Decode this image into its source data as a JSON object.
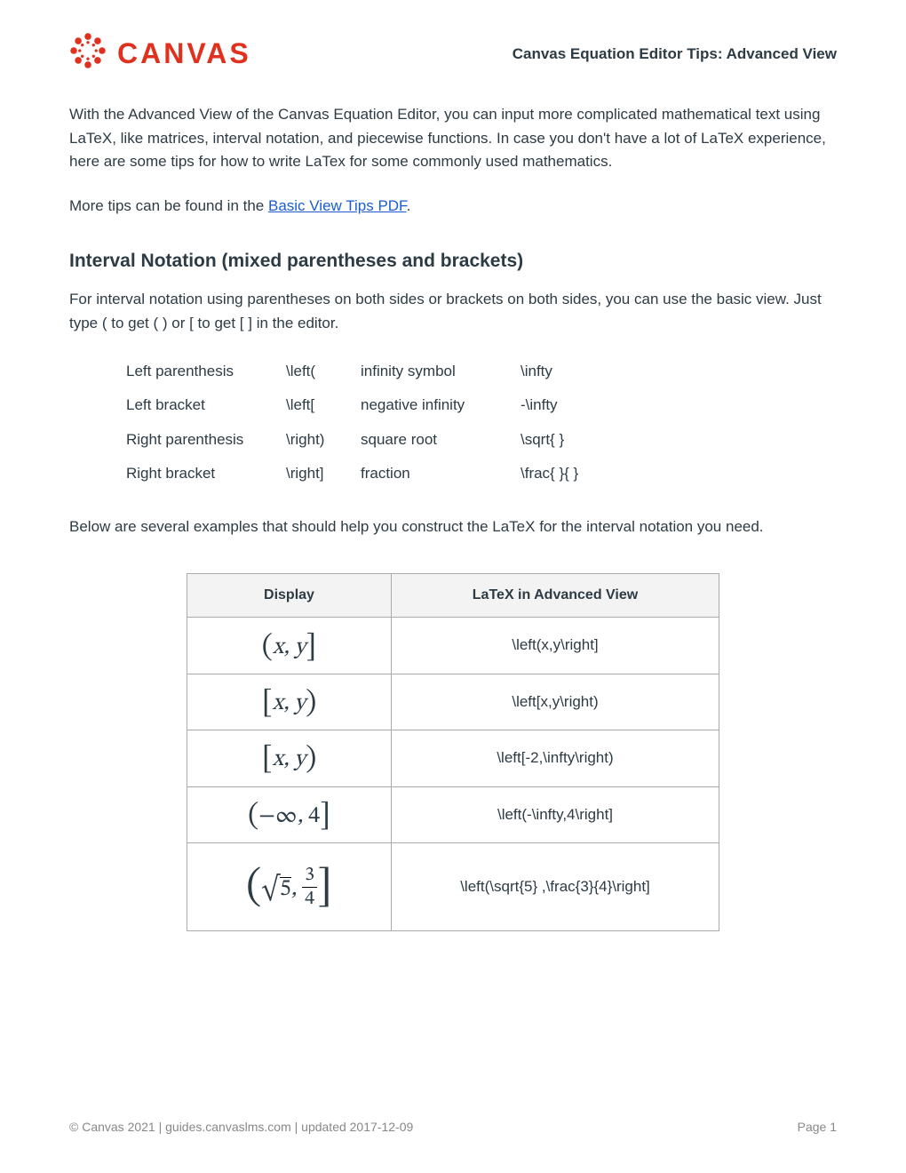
{
  "header": {
    "brand": "CANVAS",
    "title": "Canvas Equation Editor Tips: Advanced View"
  },
  "intro": "With the Advanced View of the Canvas Equation Editor, you can input more complicated mathematical text using LaTeX, like matrices, interval notation, and piecewise functions. In case you don't have a lot of LaTeX experience, here are some tips for how to write LaTex for some commonly used mathematics.",
  "more_tips_prefix": "More tips can be found in the ",
  "more_tips_link": "Basic View Tips PDF",
  "more_tips_suffix": ".",
  "section": {
    "title": "Interval Notation (mixed parentheses and brackets)",
    "desc": "For interval notation using parentheses on both sides or brackets on both sides, you can use the basic view. Just type ( to get ( ) or [ to get [ ] in the editor."
  },
  "sym_rows": [
    {
      "c1": "Left parenthesis",
      "c2": "\\left(",
      "c3": "infinity symbol",
      "c4": "\\infty"
    },
    {
      "c1": "Left bracket",
      "c2": "\\left[",
      "c3": "negative infinity",
      "c4": "-\\infty"
    },
    {
      "c1": "Right parenthesis",
      "c2": "\\right)",
      "c3": "square root",
      "c4": "\\sqrt{ }"
    },
    {
      "c1": "Right bracket",
      "c2": "\\right]",
      "c3": "fraction",
      "c4": "\\frac{ }{ }"
    }
  ],
  "below": "Below are several examples that should help you construct the LaTeX for the interval notation you need.",
  "ex_headers": {
    "display": "Display",
    "latex": "LaTeX in Advanced View"
  },
  "ex_rows": [
    {
      "latex": "\\left(x,y\\right]"
    },
    {
      "latex": "\\left[x,y\\right)"
    },
    {
      "latex": "\\left[-2,\\infty\\right)"
    },
    {
      "latex": "\\left(-\\infty,4\\right]"
    },
    {
      "latex": "\\left(\\sqrt{5} ,\\frac{3}{4}\\right]"
    }
  ],
  "footer": {
    "left": "© Canvas 2021 | guides.canvaslms.com | updated 2017-12-09",
    "right": "Page 1"
  }
}
